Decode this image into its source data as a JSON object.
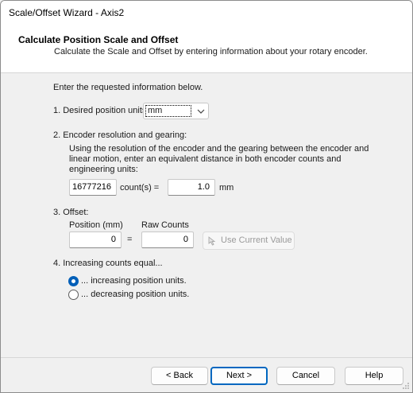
{
  "window": {
    "title": "Scale/Offset Wizard - Axis2"
  },
  "header": {
    "title": "Calculate Position Scale and Offset",
    "subtitle": "Calculate the Scale and Offset by entering information about your rotary encoder."
  },
  "intro": "Enter the requested information below.",
  "step1": {
    "label": "1. Desired position units:",
    "selected": "mm"
  },
  "step2": {
    "label": "2. Encoder resolution and gearing:",
    "description_line1": "Using the resolution of the encoder and the gearing between the encoder and",
    "description_line2": "linear motion, enter an equivalent distance in both encoder counts and",
    "description_line3": "engineering units:",
    "counts_value": "16777216",
    "counts_label": "count(s) =",
    "distance_value": "1.0",
    "distance_unit": "mm"
  },
  "step3": {
    "label": "3. Offset:",
    "position_header": "Position (mm)",
    "raw_header": "Raw Counts",
    "position_value": "0",
    "equals": "=",
    "raw_value": "0",
    "use_current_label": "Use Current Value"
  },
  "step4": {
    "label": "4. Increasing counts equal...",
    "option_increasing": "... increasing position units.",
    "option_decreasing": "... decreasing position units.",
    "selected": "increasing"
  },
  "buttons": {
    "back": "< Back",
    "next": "Next >",
    "cancel": "Cancel",
    "help": "Help"
  }
}
